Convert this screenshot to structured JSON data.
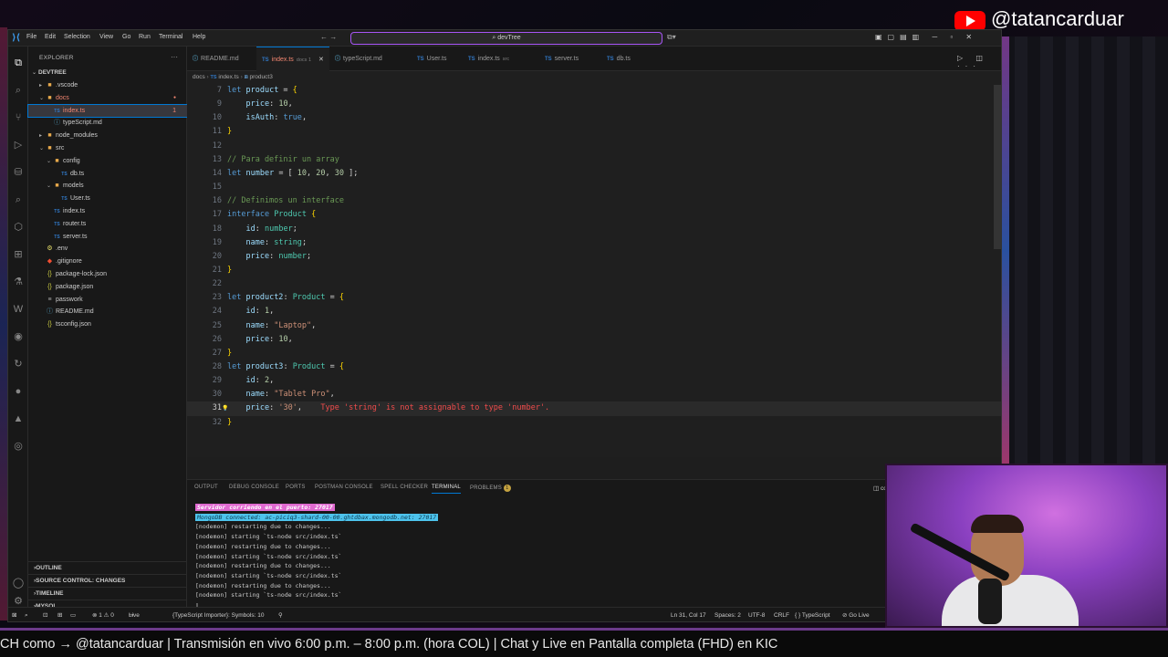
{
  "overlay": {
    "youtube_handle": "@tatancarduar",
    "ticker_text": "CH como → @tatancarduar    |    Transmisión en vivo  6:00 p.m. – 8:00 p.m. (hora COL)   |  Chat y Live en Pantalla completa (FHD)  en KIC"
  },
  "titlebar": {
    "menus": [
      "File",
      "Edit",
      "Selection",
      "View",
      "Go",
      "Run",
      "Terminal",
      "Help"
    ],
    "search": "devTree",
    "nav": "←  →"
  },
  "sidebar": {
    "title": "EXPLORER",
    "root": "DEVTREE",
    "tree": [
      {
        "label": ".vscode",
        "type": "folder",
        "depth": 1
      },
      {
        "label": "docs",
        "type": "folder-open",
        "depth": 1,
        "error": true
      },
      {
        "label": "index.ts",
        "type": "ts",
        "depth": 2,
        "active": true,
        "badge": "1"
      },
      {
        "label": "typeScript.md",
        "type": "md",
        "depth": 2
      },
      {
        "label": "node_modules",
        "type": "folder",
        "depth": 1
      },
      {
        "label": "src",
        "type": "folder-open",
        "depth": 1
      },
      {
        "label": "config",
        "type": "folder-open",
        "depth": 2
      },
      {
        "label": "db.ts",
        "type": "ts",
        "depth": 3
      },
      {
        "label": "models",
        "type": "folder-open",
        "depth": 2
      },
      {
        "label": "User.ts",
        "type": "ts",
        "depth": 3
      },
      {
        "label": "index.ts",
        "type": "ts",
        "depth": 2
      },
      {
        "label": "router.ts",
        "type": "ts",
        "depth": 2
      },
      {
        "label": "server.ts",
        "type": "ts",
        "depth": 2
      },
      {
        "label": ".env",
        "type": "env",
        "depth": 1
      },
      {
        "label": ".gitignore",
        "type": "git",
        "depth": 1
      },
      {
        "label": "package-lock.json",
        "type": "json",
        "depth": 1
      },
      {
        "label": "package.json",
        "type": "json",
        "depth": 1
      },
      {
        "label": "passwork",
        "type": "file",
        "depth": 1
      },
      {
        "label": "README.md",
        "type": "md",
        "depth": 1
      },
      {
        "label": "tsconfig.json",
        "type": "json",
        "depth": 1
      }
    ],
    "sections": [
      "OUTLINE",
      "SOURCE CONTROL: CHANGES",
      "TIMELINE",
      "MYSQL"
    ]
  },
  "tabs": [
    {
      "label": "README.md",
      "icon": "md",
      "sub": ""
    },
    {
      "label": "index.ts",
      "icon": "ts",
      "sub": "docs 1",
      "active": true
    },
    {
      "label": "typeScript.md",
      "icon": "md",
      "sub": ""
    },
    {
      "label": "User.ts",
      "icon": "ts",
      "sub": ""
    },
    {
      "label": "index.ts",
      "icon": "ts",
      "sub": "src"
    },
    {
      "label": "server.ts",
      "icon": "ts",
      "sub": ""
    },
    {
      "label": "db.ts",
      "icon": "ts",
      "sub": ""
    }
  ],
  "breadcrumb": [
    "docs",
    "index.ts",
    "product3"
  ],
  "code_lines": [
    {
      "n": "7",
      "tokens": [
        [
          "kw",
          "let "
        ],
        [
          "var",
          "product"
        ],
        [
          "pn",
          " = "
        ],
        [
          "br",
          "{"
        ]
      ]
    },
    {
      "n": "9",
      "tokens": [
        [
          "pn",
          "    "
        ],
        [
          "var",
          "price"
        ],
        [
          "pn",
          ": "
        ],
        [
          "num",
          "10"
        ],
        [
          "pn",
          ","
        ]
      ]
    },
    {
      "n": "10",
      "tokens": [
        [
          "pn",
          "    "
        ],
        [
          "var",
          "isAuth"
        ],
        [
          "pn",
          ": "
        ],
        [
          "kw",
          "true"
        ],
        [
          "pn",
          ","
        ]
      ]
    },
    {
      "n": "11",
      "tokens": [
        [
          "br",
          "}"
        ]
      ]
    },
    {
      "n": "12",
      "tokens": []
    },
    {
      "n": "13",
      "tokens": [
        [
          "cm",
          "// Para definir un array"
        ]
      ]
    },
    {
      "n": "14",
      "tokens": [
        [
          "kw",
          "let "
        ],
        [
          "var",
          "number"
        ],
        [
          "pn",
          " = [ "
        ],
        [
          "num",
          "10"
        ],
        [
          "pn",
          ", "
        ],
        [
          "num",
          "20"
        ],
        [
          "pn",
          ", "
        ],
        [
          "num",
          "30"
        ],
        [
          "pn",
          " ];"
        ]
      ]
    },
    {
      "n": "15",
      "tokens": []
    },
    {
      "n": "16",
      "tokens": [
        [
          "cm",
          "// Definimos un interface"
        ]
      ]
    },
    {
      "n": "17",
      "tokens": [
        [
          "kw",
          "interface "
        ],
        [
          "ty",
          "Product"
        ],
        [
          "pn",
          " "
        ],
        [
          "br",
          "{"
        ]
      ]
    },
    {
      "n": "18",
      "tokens": [
        [
          "pn",
          "    "
        ],
        [
          "var",
          "id"
        ],
        [
          "pn",
          ": "
        ],
        [
          "ty",
          "number"
        ],
        [
          "pn",
          ";"
        ]
      ]
    },
    {
      "n": "19",
      "tokens": [
        [
          "pn",
          "    "
        ],
        [
          "var",
          "name"
        ],
        [
          "pn",
          ": "
        ],
        [
          "ty",
          "string"
        ],
        [
          "pn",
          ";"
        ]
      ]
    },
    {
      "n": "20",
      "tokens": [
        [
          "pn",
          "    "
        ],
        [
          "var",
          "price"
        ],
        [
          "pn",
          ": "
        ],
        [
          "ty",
          "number"
        ],
        [
          "pn",
          ";"
        ]
      ]
    },
    {
      "n": "21",
      "tokens": [
        [
          "br",
          "}"
        ]
      ]
    },
    {
      "n": "22",
      "tokens": []
    },
    {
      "n": "23",
      "tokens": [
        [
          "kw",
          "let "
        ],
        [
          "var",
          "product2"
        ],
        [
          "pn",
          ": "
        ],
        [
          "ty",
          "Product"
        ],
        [
          "pn",
          " = "
        ],
        [
          "br",
          "{"
        ]
      ]
    },
    {
      "n": "24",
      "tokens": [
        [
          "pn",
          "    "
        ],
        [
          "var",
          "id"
        ],
        [
          "pn",
          ": "
        ],
        [
          "num",
          "1"
        ],
        [
          "pn",
          ","
        ]
      ]
    },
    {
      "n": "25",
      "tokens": [
        [
          "pn",
          "    "
        ],
        [
          "var",
          "name"
        ],
        [
          "pn",
          ": "
        ],
        [
          "str",
          "\"Laptop\""
        ],
        [
          "pn",
          ","
        ]
      ]
    },
    {
      "n": "26",
      "tokens": [
        [
          "pn",
          "    "
        ],
        [
          "var",
          "price"
        ],
        [
          "pn",
          ": "
        ],
        [
          "num",
          "10"
        ],
        [
          "pn",
          ","
        ]
      ]
    },
    {
      "n": "27",
      "tokens": [
        [
          "br",
          "}"
        ]
      ]
    },
    {
      "n": "28",
      "tokens": [
        [
          "kw",
          "let "
        ],
        [
          "var",
          "product3"
        ],
        [
          "pn",
          ": "
        ],
        [
          "ty",
          "Product"
        ],
        [
          "pn",
          " = "
        ],
        [
          "br",
          "{"
        ]
      ]
    },
    {
      "n": "29",
      "tokens": [
        [
          "pn",
          "    "
        ],
        [
          "var",
          "id"
        ],
        [
          "pn",
          ": "
        ],
        [
          "num",
          "2"
        ],
        [
          "pn",
          ","
        ]
      ]
    },
    {
      "n": "30",
      "tokens": [
        [
          "pn",
          "    "
        ],
        [
          "var",
          "name"
        ],
        [
          "pn",
          ": "
        ],
        [
          "str",
          "\"Tablet Pro\""
        ],
        [
          "pn",
          ","
        ]
      ]
    },
    {
      "n": "31",
      "tokens": [
        [
          "pn",
          "    "
        ],
        [
          "var",
          "price"
        ],
        [
          "pn",
          ": "
        ],
        [
          "str",
          "'30'"
        ],
        [
          "pn",
          ","
        ],
        [
          "pn",
          "    "
        ],
        [
          "err",
          "Type 'string' is not assignable to type 'number'."
        ]
      ],
      "current": true
    },
    {
      "n": "32",
      "tokens": [
        [
          "br",
          "}"
        ]
      ]
    }
  ],
  "panel": {
    "tabs": [
      "OUTPUT",
      "DEBUG CONSOLE",
      "PORTS",
      "POSTMAN CONSOLE",
      "SPELL CHECKER",
      "TERMINAL",
      "PROBLEMS"
    ],
    "active_tab": "TERMINAL",
    "problems_count": "1",
    "terminal_lines": [
      {
        "text": "Servidor corriendo en el puerto: 27017",
        "style": "hl1"
      },
      {
        "text": "MongoDB connected: ac-piciq3-shard-00-00.ghtdbax.mongodb.net: 27017",
        "style": "hl2"
      },
      {
        "text": "[nodemon] restarting due to changes...",
        "style": "plain"
      },
      {
        "text": "[nodemon] starting `ts-node src/index.ts`",
        "style": "plain"
      },
      {
        "text": "[nodemon] restarting due to changes...",
        "style": "plain"
      },
      {
        "text": "[nodemon] starting `ts-node src/index.ts`",
        "style": "plain"
      },
      {
        "text": "[nodemon] restarting due to changes...",
        "style": "plain"
      },
      {
        "text": "[nodemon] starting `ts-node src/index.ts`",
        "style": "plain"
      },
      {
        "text": "[nodemon] restarting due to changes...",
        "style": "plain"
      },
      {
        "text": "[nodemon] starting `ts-node src/index.ts`",
        "style": "plain"
      }
    ],
    "cursor": "▯"
  },
  "statusbar": {
    "problems": "⊗ 1 ⚠ 0",
    "live_share": "Live Share",
    "ts_importer": "{TypeScript Importer}: Symbols: 10",
    "position": "Ln 31, Col 17",
    "spaces": "Spaces: 2",
    "encoding": "UTF-8",
    "eol": "CRLF",
    "language": "{ } TypeScript",
    "golive": "⊘ Go Live"
  },
  "colors": {
    "accent": "#0078d4",
    "search_border": "#a855f7",
    "error": "#f14c4c"
  }
}
